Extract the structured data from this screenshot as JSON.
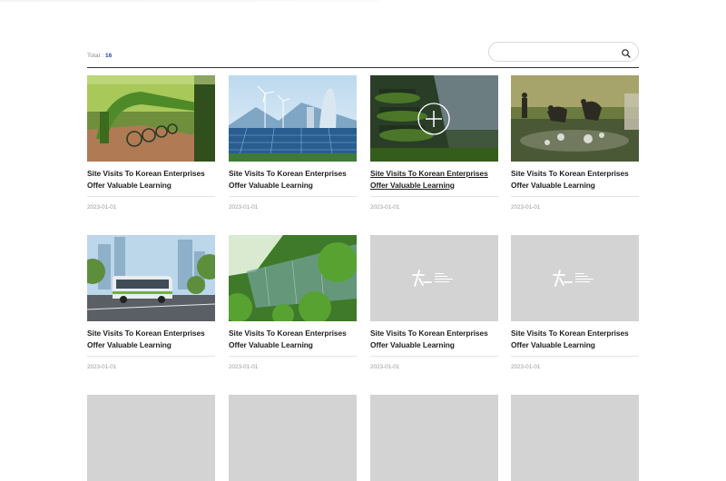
{
  "list": {
    "total_label": "Total :",
    "total_count": "16"
  },
  "search": {
    "value": "",
    "placeholder": "",
    "icon": "search-icon"
  },
  "cards": [
    {
      "title_line1": "Site Visits To Korean Enterprises",
      "title_line2": "Offer Valuable Learning",
      "date": "2023-01-01",
      "image": "green-bicycle-station"
    },
    {
      "title_line1": "Site Visits To Korean Enterprises",
      "title_line2": "Offer Valuable Learning",
      "date": "2023-01-01",
      "image": "wind-turbines-solar-city"
    },
    {
      "title_line1": "Site Visits To Korean Enterprises",
      "title_line2": "Offer Valuable Learning",
      "date": "2023-01-01",
      "image": "green-building-hover"
    },
    {
      "title_line1": "Site Visits To Korean Enterprises",
      "title_line2": "Offer Valuable Learning",
      "date": "2023-01-01",
      "image": "people-cleaning-river"
    },
    {
      "title_line1": "Site Visits To Korean Enterprises",
      "title_line2": "Offer Valuable Learning",
      "date": "2023-01-01",
      "image": "electric-bus-city"
    },
    {
      "title_line1": "Site Visits To Korean Enterprises",
      "title_line2": "Offer Valuable Learning",
      "date": "2023-01-01",
      "image": "green-glass-building"
    },
    {
      "title_line1": "Site Visits To Korean Enterprises",
      "title_line2": "Offer Valuable Learning",
      "date": "2023-01-01",
      "image": "placeholder-logo"
    },
    {
      "title_line1": "Site Visits To Korean Enterprises",
      "title_line2": "Offer Valuable Learning",
      "date": "2023-01-01",
      "image": "placeholder-logo"
    }
  ]
}
